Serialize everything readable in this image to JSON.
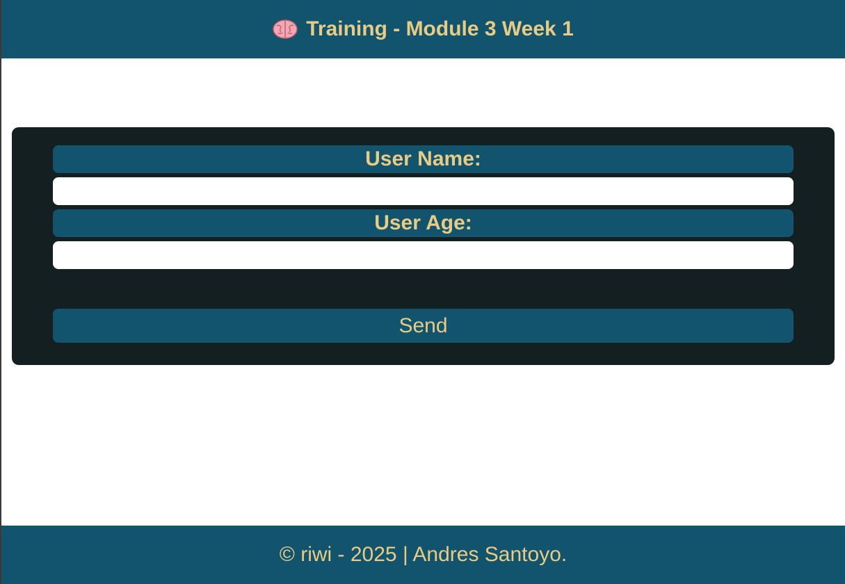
{
  "header": {
    "icon": "brain-icon",
    "title": "Training - Module 3 Week 1"
  },
  "form": {
    "username_label": "User Name:",
    "username_value": "",
    "age_label": "User Age:",
    "age_value": "",
    "submit_label": "Send"
  },
  "footer": {
    "text": "© riwi - 2025 | Andres Santoyo."
  },
  "colors": {
    "primary": "#12536d",
    "accent": "#e9cc84",
    "card": "#131f20",
    "background": "#ffffff"
  }
}
